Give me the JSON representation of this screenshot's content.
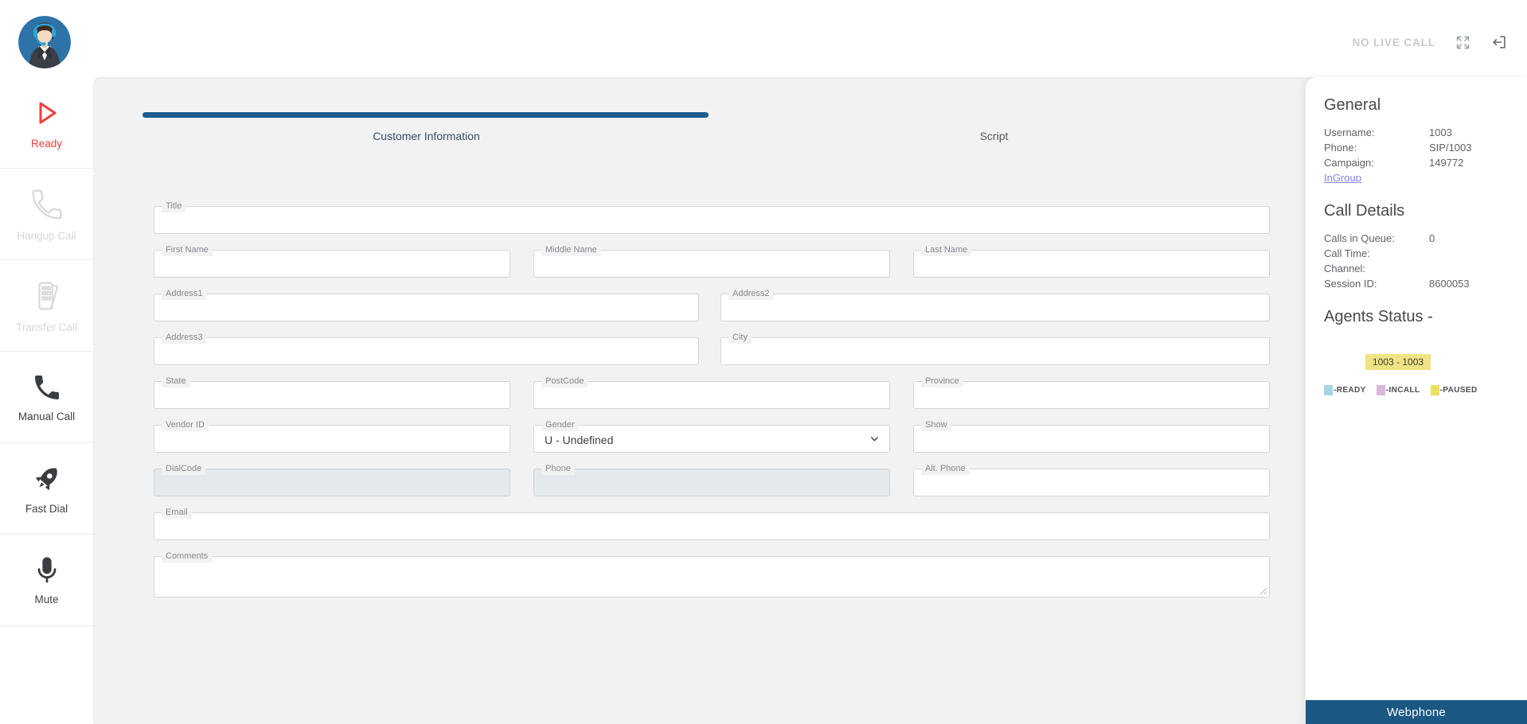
{
  "header": {
    "status_text": "NO LIVE CALL"
  },
  "sidebar": {
    "items": [
      {
        "id": "ready",
        "label": "Ready",
        "state": "active"
      },
      {
        "id": "hangup-call",
        "label": "Hangup Call",
        "state": "disabled"
      },
      {
        "id": "transfer-call",
        "label": "Transfer Call",
        "state": "disabled"
      },
      {
        "id": "manual-call",
        "label": "Manual Call",
        "state": "enabled"
      },
      {
        "id": "fast-dial",
        "label": "Fast Dial",
        "state": "enabled"
      },
      {
        "id": "mute",
        "label": "Mute",
        "state": "enabled"
      }
    ]
  },
  "tabs": {
    "items": [
      {
        "label": "Customer Information",
        "active": true
      },
      {
        "label": "Script",
        "active": false
      }
    ]
  },
  "form": {
    "title": {
      "label": "Title",
      "value": ""
    },
    "first_name": {
      "label": "First Name",
      "value": ""
    },
    "middle_name": {
      "label": "Middle Name",
      "value": ""
    },
    "last_name": {
      "label": "Last Name",
      "value": ""
    },
    "address1": {
      "label": "Address1",
      "value": ""
    },
    "address2": {
      "label": "Address2",
      "value": ""
    },
    "address3": {
      "label": "Address3",
      "value": ""
    },
    "city": {
      "label": "City",
      "value": ""
    },
    "state": {
      "label": "State",
      "value": ""
    },
    "postcode": {
      "label": "PostCode",
      "value": ""
    },
    "province": {
      "label": "Province",
      "value": ""
    },
    "vendor_id": {
      "label": "Vendor ID",
      "value": ""
    },
    "gender": {
      "label": "Gender",
      "value": "U - Undefined"
    },
    "show": {
      "label": "Show",
      "value": ""
    },
    "dialcode": {
      "label": "DialCode",
      "value": "",
      "disabled": true
    },
    "phone": {
      "label": "Phone",
      "value": "",
      "disabled": true
    },
    "alt_phone": {
      "label": "Alt. Phone",
      "value": ""
    },
    "email": {
      "label": "Email",
      "value": ""
    },
    "comments": {
      "label": "Comments",
      "value": ""
    }
  },
  "panel": {
    "general": {
      "title": "General",
      "rows": [
        {
          "label": "Username:",
          "value": "1003"
        },
        {
          "label": "Phone:",
          "value": "SIP/1003"
        },
        {
          "label": "Campaign:",
          "value": "149772"
        }
      ],
      "link": "InGroup"
    },
    "call_details": {
      "title": "Call Details",
      "rows": [
        {
          "label": "Calls in Queue:",
          "value": "0"
        },
        {
          "label": "Call Time:",
          "value": ""
        },
        {
          "label": "Channel:",
          "value": ""
        },
        {
          "label": "Session ID:",
          "value": "8600053"
        }
      ]
    },
    "agents_status": {
      "title": "Agents Status -",
      "badge": "1003 - 1003",
      "legend": [
        {
          "label": "-READY",
          "color": "#a5d5e2"
        },
        {
          "label": "-INCALL",
          "color": "#d9b8d9"
        },
        {
          "label": "-PAUSED",
          "color": "#ece063"
        }
      ]
    },
    "webphone_label": "Webphone"
  },
  "colors": {
    "accent_blue": "#1d5c8d",
    "webphone_blue": "#1b5884",
    "ready_red": "#e8413c",
    "badge_yellow": "#f0e385",
    "legend_ready": "#a5d5e2",
    "legend_incall": "#d9b8d9",
    "legend_paused": "#ece063",
    "link_purple": "#8181f1",
    "status_gray": "#c7cacc"
  }
}
